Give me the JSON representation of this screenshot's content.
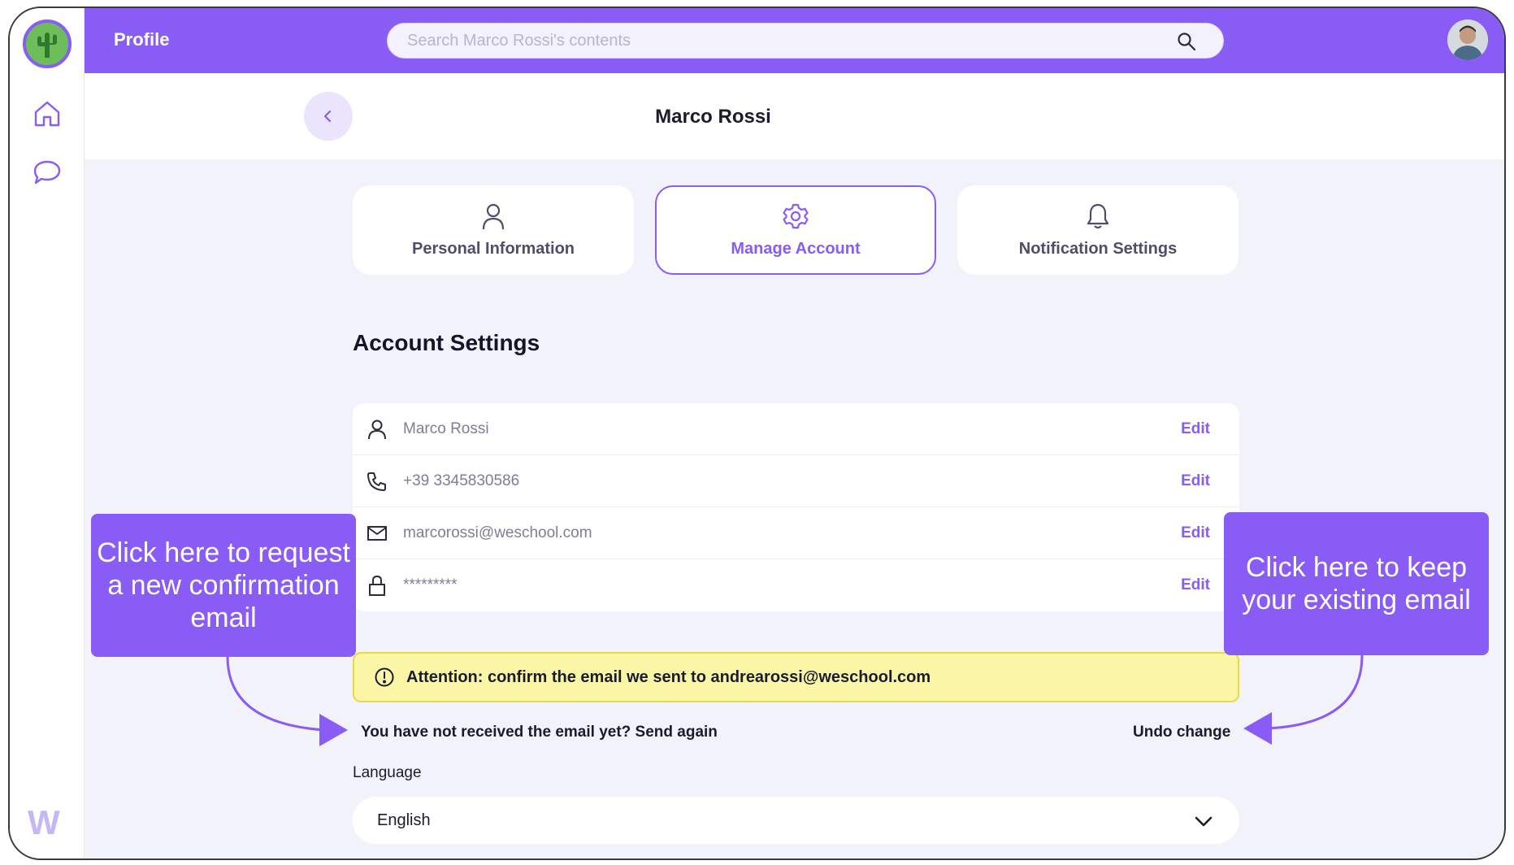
{
  "topbar": {
    "title": "Profile",
    "search_placeholder": "Search Marco Rossi's contents"
  },
  "header": {
    "title": "Marco Rossi"
  },
  "tabs": [
    {
      "label": "Personal Information",
      "icon": "user-icon",
      "active": false
    },
    {
      "label": "Manage Account",
      "icon": "gear-icon",
      "active": true
    },
    {
      "label": "Notification Settings",
      "icon": "bell-icon",
      "active": false
    }
  ],
  "account_settings": {
    "title": "Account Settings",
    "rows": [
      {
        "icon": "user-icon",
        "value": "Marco Rossi",
        "action": "Edit"
      },
      {
        "icon": "phone-icon",
        "value": "+39 3345830586",
        "action": "Edit"
      },
      {
        "icon": "mail-icon",
        "value": "marcorossi@weschool.com",
        "action": "Edit"
      },
      {
        "icon": "lock-icon",
        "value": "*********",
        "action": "Edit"
      }
    ]
  },
  "alert": {
    "text": "Attention: confirm the email we sent to andrearossi@weschool.com"
  },
  "email_actions": {
    "resend": "You have not received the email yet? Send again",
    "undo": "Undo change"
  },
  "language": {
    "label": "Language",
    "value": "English"
  },
  "callouts": {
    "left": "Click here to request a new confirmation email",
    "right": "Click here to keep your existing email"
  },
  "sidebar": {
    "brand": "W"
  },
  "colors": {
    "accent": "#8a5cf6",
    "alert_bg": "#faf6a6",
    "page_bg": "#f2f2fb"
  }
}
